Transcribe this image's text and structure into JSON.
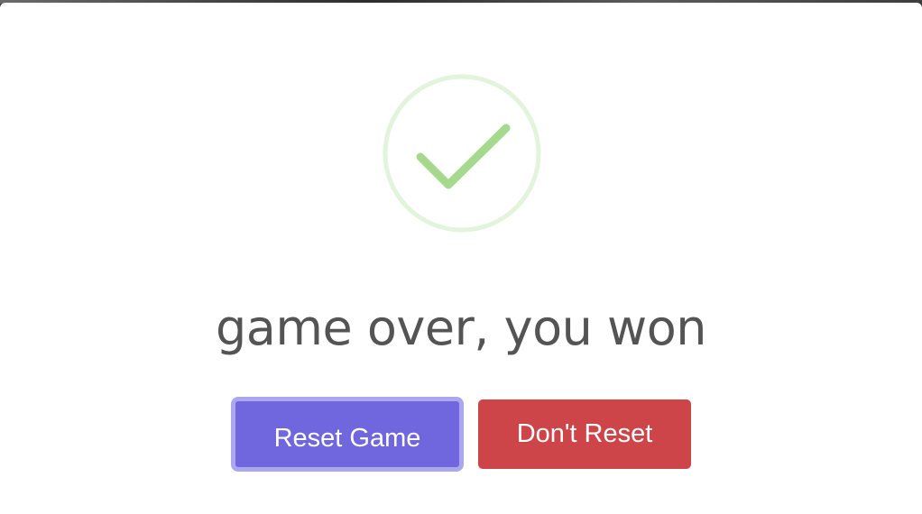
{
  "dialog": {
    "icon": "success-checkmark-icon",
    "title": "game over, you won",
    "confirm_label": "Reset Game",
    "cancel_label": "Don't Reset"
  },
  "colors": {
    "icon_ring": "#e3f4dc",
    "icon_check": "#a5d98e",
    "title_text": "#545454",
    "confirm_bg": "#7066dd",
    "confirm_focus_ring": "#aba7ee",
    "cancel_bg": "#cd4549"
  }
}
